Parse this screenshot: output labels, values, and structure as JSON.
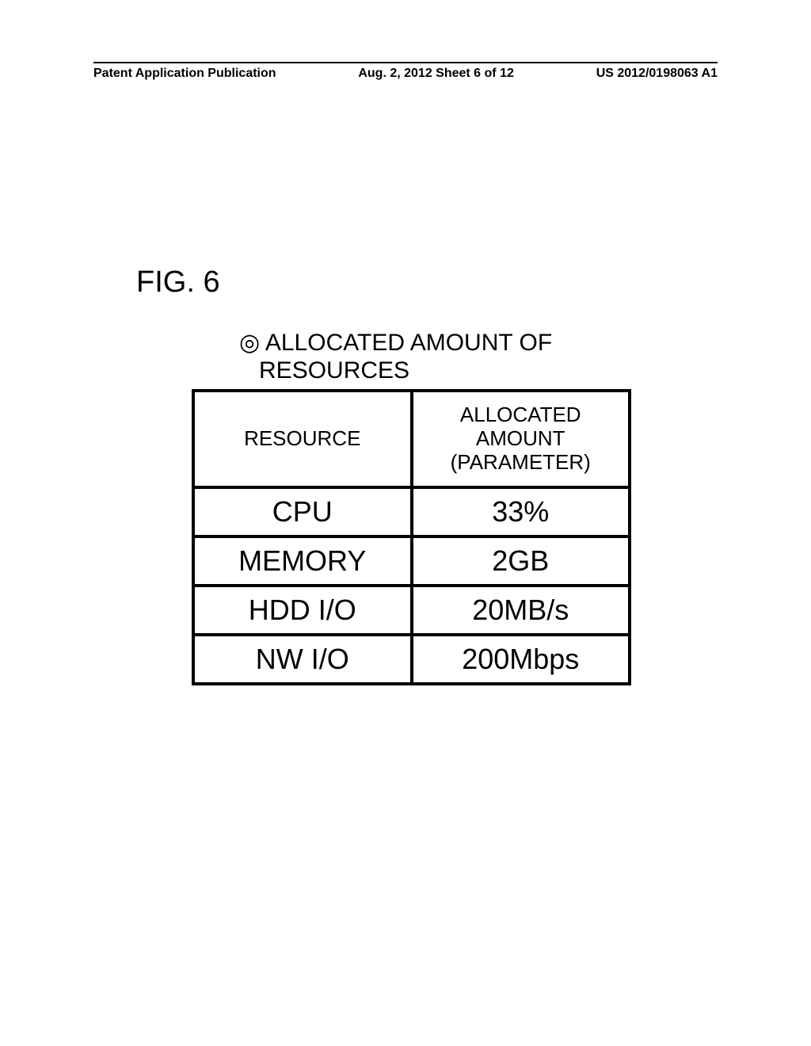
{
  "header": {
    "left": "Patent Application Publication",
    "center": "Aug. 2, 2012  Sheet 6 of 12",
    "right": "US 2012/0198063 A1"
  },
  "figure": {
    "label": "FIG. 6",
    "table_title_line1": "◎ ALLOCATED AMOUNT OF",
    "table_title_line2": "RESOURCES"
  },
  "chart_data": {
    "type": "table",
    "title": "ALLOCATED AMOUNT OF RESOURCES",
    "columns": [
      "RESOURCE",
      "ALLOCATED AMOUNT (PARAMETER)"
    ],
    "rows": [
      {
        "resource": "CPU",
        "amount": "33%"
      },
      {
        "resource": "MEMORY",
        "amount": "2GB"
      },
      {
        "resource": "HDD I/O",
        "amount": "20MB/s"
      },
      {
        "resource": "NW I/O",
        "amount": "200Mbps"
      }
    ]
  },
  "table": {
    "headers": {
      "col1": "RESOURCE",
      "col2_l1": "ALLOCATED",
      "col2_l2": "AMOUNT",
      "col2_l3": "(PARAMETER)"
    },
    "rows": [
      {
        "c1": "CPU",
        "c2": "33%"
      },
      {
        "c1": "MEMORY",
        "c2": "2GB"
      },
      {
        "c1": "HDD I/O",
        "c2": "20MB/s"
      },
      {
        "c1": "NW I/O",
        "c2": "200Mbps"
      }
    ]
  }
}
